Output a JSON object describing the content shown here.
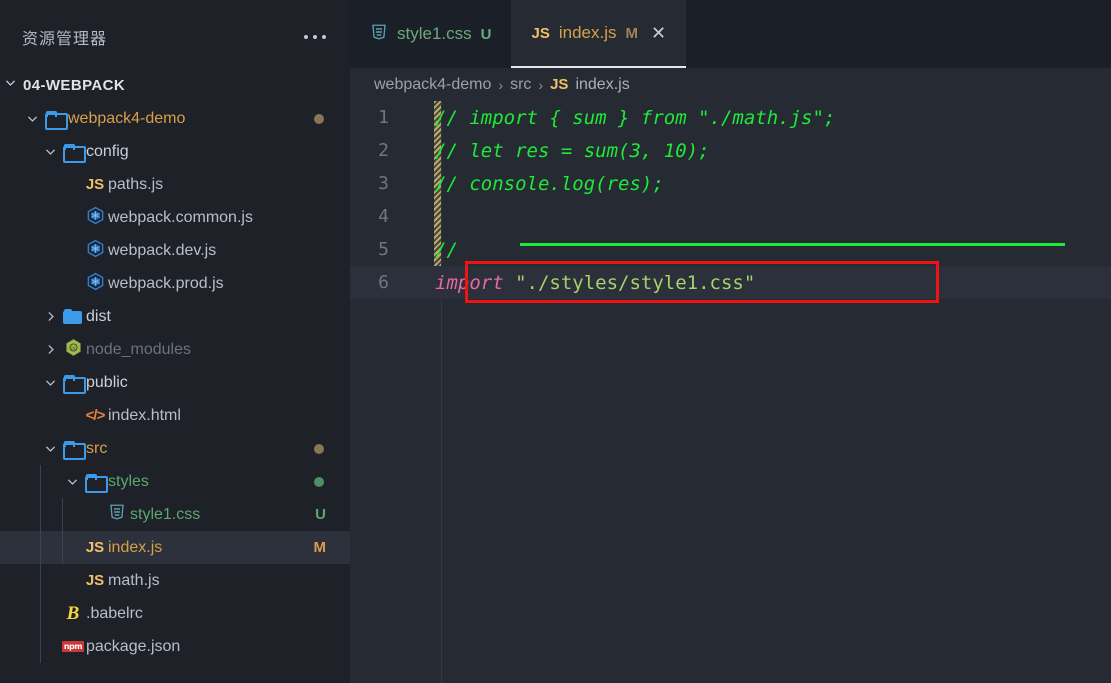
{
  "window": {
    "title": "Visual Studio Code"
  },
  "sidebar": {
    "header": {
      "title": "资源管理器",
      "menu_icon": "kebab-menu-icon"
    },
    "root": {
      "label": "04-WEBPACK",
      "expanded": true
    },
    "items": [
      {
        "label": "webpack4-demo",
        "icon": "folder-open-icon",
        "kind": "folder",
        "twisty": "chevron-down",
        "depth": 1,
        "color": "#d6a04a",
        "dot": "#8a7654",
        "badge": ""
      },
      {
        "label": "config",
        "icon": "folder-open-icon",
        "kind": "folder",
        "twisty": "chevron-down",
        "depth": 2,
        "color": "#c9d0da",
        "dot": "",
        "badge": ""
      },
      {
        "label": "paths.js",
        "icon": "js-icon",
        "kind": "file",
        "twisty": "",
        "depth": 3,
        "color": "#b8bfc9",
        "dot": "",
        "badge": ""
      },
      {
        "label": "webpack.common.js",
        "icon": "webpack-icon",
        "kind": "file",
        "twisty": "",
        "depth": 3,
        "color": "#b8bfc9",
        "dot": "",
        "badge": ""
      },
      {
        "label": "webpack.dev.js",
        "icon": "webpack-icon",
        "kind": "file",
        "twisty": "",
        "depth": 3,
        "color": "#b8bfc9",
        "dot": "",
        "badge": ""
      },
      {
        "label": "webpack.prod.js",
        "icon": "webpack-icon",
        "kind": "file",
        "twisty": "",
        "depth": 3,
        "color": "#b8bfc9",
        "dot": "",
        "badge": ""
      },
      {
        "label": "dist",
        "icon": "folder-filled-icon",
        "kind": "folder",
        "twisty": "chevron-right",
        "depth": 2,
        "color": "#c9d0da",
        "dot": "",
        "badge": ""
      },
      {
        "label": "node_modules",
        "icon": "nodejs-icon",
        "kind": "folder",
        "twisty": "chevron-right",
        "depth": 2,
        "color": "#6b737f",
        "dot": "",
        "badge": ""
      },
      {
        "label": "public",
        "icon": "folder-open-icon",
        "kind": "folder",
        "twisty": "chevron-down",
        "depth": 2,
        "color": "#c9d0da",
        "dot": "",
        "badge": ""
      },
      {
        "label": "index.html",
        "icon": "html-icon",
        "kind": "file",
        "twisty": "",
        "depth": 3,
        "color": "#b8bfc9",
        "dot": "",
        "badge": ""
      },
      {
        "label": "src",
        "icon": "folder-open-icon",
        "kind": "folder",
        "twisty": "chevron-down",
        "depth": 2,
        "color": "#d6a04a",
        "dot": "#8a7654",
        "badge": ""
      },
      {
        "label": "styles",
        "icon": "folder-open-icon",
        "kind": "folder",
        "twisty": "chevron-down",
        "depth": 3,
        "color": "#5aa86f",
        "dot": "#4e8f63",
        "badge": ""
      },
      {
        "label": "style1.css",
        "icon": "css-icon",
        "kind": "file",
        "twisty": "",
        "depth": 4,
        "color": "#5aa86f",
        "dot": "",
        "badge": "U",
        "badge_color": "#5aa86f"
      },
      {
        "label": "index.js",
        "icon": "js-icon",
        "kind": "file",
        "twisty": "",
        "depth": 3,
        "color": "#d6a04a",
        "dot": "",
        "badge": "M",
        "badge_color": "#d6a04a",
        "selected": true
      },
      {
        "label": "math.js",
        "icon": "js-icon",
        "kind": "file",
        "twisty": "",
        "depth": 3,
        "color": "#b8bfc9",
        "dot": "",
        "badge": ""
      },
      {
        "label": ".babelrc",
        "icon": "babel-icon",
        "kind": "file",
        "twisty": "",
        "depth": 2,
        "color": "#b8bfc9",
        "dot": "",
        "badge": ""
      },
      {
        "label": "package.json",
        "icon": "npm-icon",
        "kind": "file",
        "twisty": "",
        "depth": 2,
        "color": "#b8bfc9",
        "dot": "",
        "badge": ""
      }
    ]
  },
  "editor": {
    "tabs": [
      {
        "name": "style1.css",
        "icon": "css-icon",
        "badge": "U",
        "active": false,
        "name_color": "#6aa97e",
        "badge_color": "#6aa97e",
        "close_icon": ""
      },
      {
        "name": "index.js",
        "icon": "js-icon",
        "badge": "M",
        "active": true,
        "name_color": "#d6a04a",
        "badge_color": "#a08255",
        "close_icon": "close-icon"
      }
    ],
    "breadcrumb": {
      "project": "webpack4-demo",
      "folder": "src",
      "file_icon": "js-icon",
      "file": "index.js",
      "separator": "›"
    },
    "lines": [
      {
        "num": "1",
        "tokens": [
          {
            "t": "// import { sum } from \"./math.js\";",
            "c": "cmt"
          }
        ]
      },
      {
        "num": "2",
        "tokens": [
          {
            "t": "// let res = sum(3, 10);",
            "c": "cmt"
          }
        ]
      },
      {
        "num": "3",
        "tokens": [
          {
            "t": "// console.log(res);",
            "c": "cmt"
          }
        ]
      },
      {
        "num": "4",
        "tokens": [
          {
            "t": "",
            "c": "cmt"
          }
        ]
      },
      {
        "num": "5",
        "tokens": [
          {
            "t": "// ",
            "c": "cmt"
          }
        ]
      },
      {
        "num": "6",
        "tokens": [
          {
            "t": "import",
            "c": "kw"
          },
          {
            "t": " ",
            "c": "str"
          },
          {
            "t": "\"./styles/style1.css\"",
            "c": "str"
          }
        ]
      }
    ],
    "annotation": {
      "type": "red-rectangle",
      "color": "#f11313",
      "target_line": "6"
    },
    "diff_indicator": {
      "type": "modified-hatched-strip",
      "color": "#b9ab72"
    }
  }
}
